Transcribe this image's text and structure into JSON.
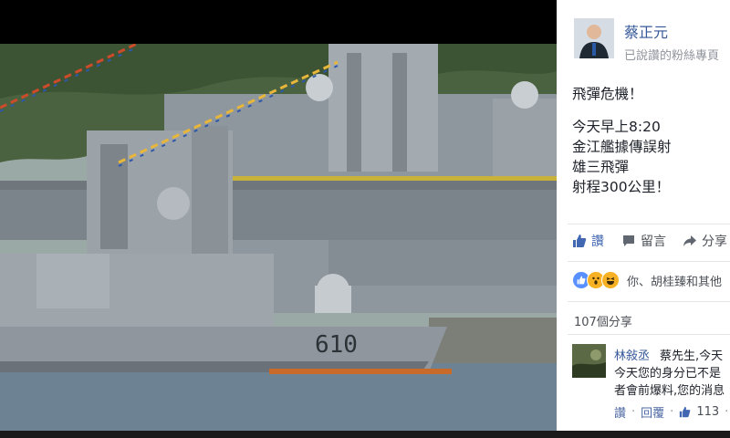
{
  "post": {
    "page_name": "蔡正元",
    "page_sub": "已說讚的粉絲專頁",
    "lines": [
      "飛彈危機！",
      "",
      "今天早上8:20",
      "金江艦據傳誤射",
      "雄三飛彈",
      "射程300公里！"
    ]
  },
  "photo": {
    "hull_number": "610",
    "colors": {
      "sea": "#6d8292",
      "hull": "#8f969d",
      "hills": "#4b6240"
    }
  },
  "actions": {
    "like": "讚",
    "comment": "留言",
    "share": "分享"
  },
  "reactions": {
    "text": "你、胡桂臻和其他"
  },
  "shares_count": "107個分享",
  "comment": {
    "author": "林敍丞",
    "lines": [
      "蔡先生,今天",
      "今天您的身分已不是",
      "者會前爆料,您的消息"
    ],
    "like": "讚",
    "reply": "回覆",
    "likes_count": "113",
    "trailing": "·"
  },
  "icons": {
    "like": "thumbs-up-icon",
    "comment": "speech-bubble-icon",
    "share": "share-arrow-icon"
  },
  "colors": {
    "link": "#365899",
    "accent": "#4267b2"
  }
}
